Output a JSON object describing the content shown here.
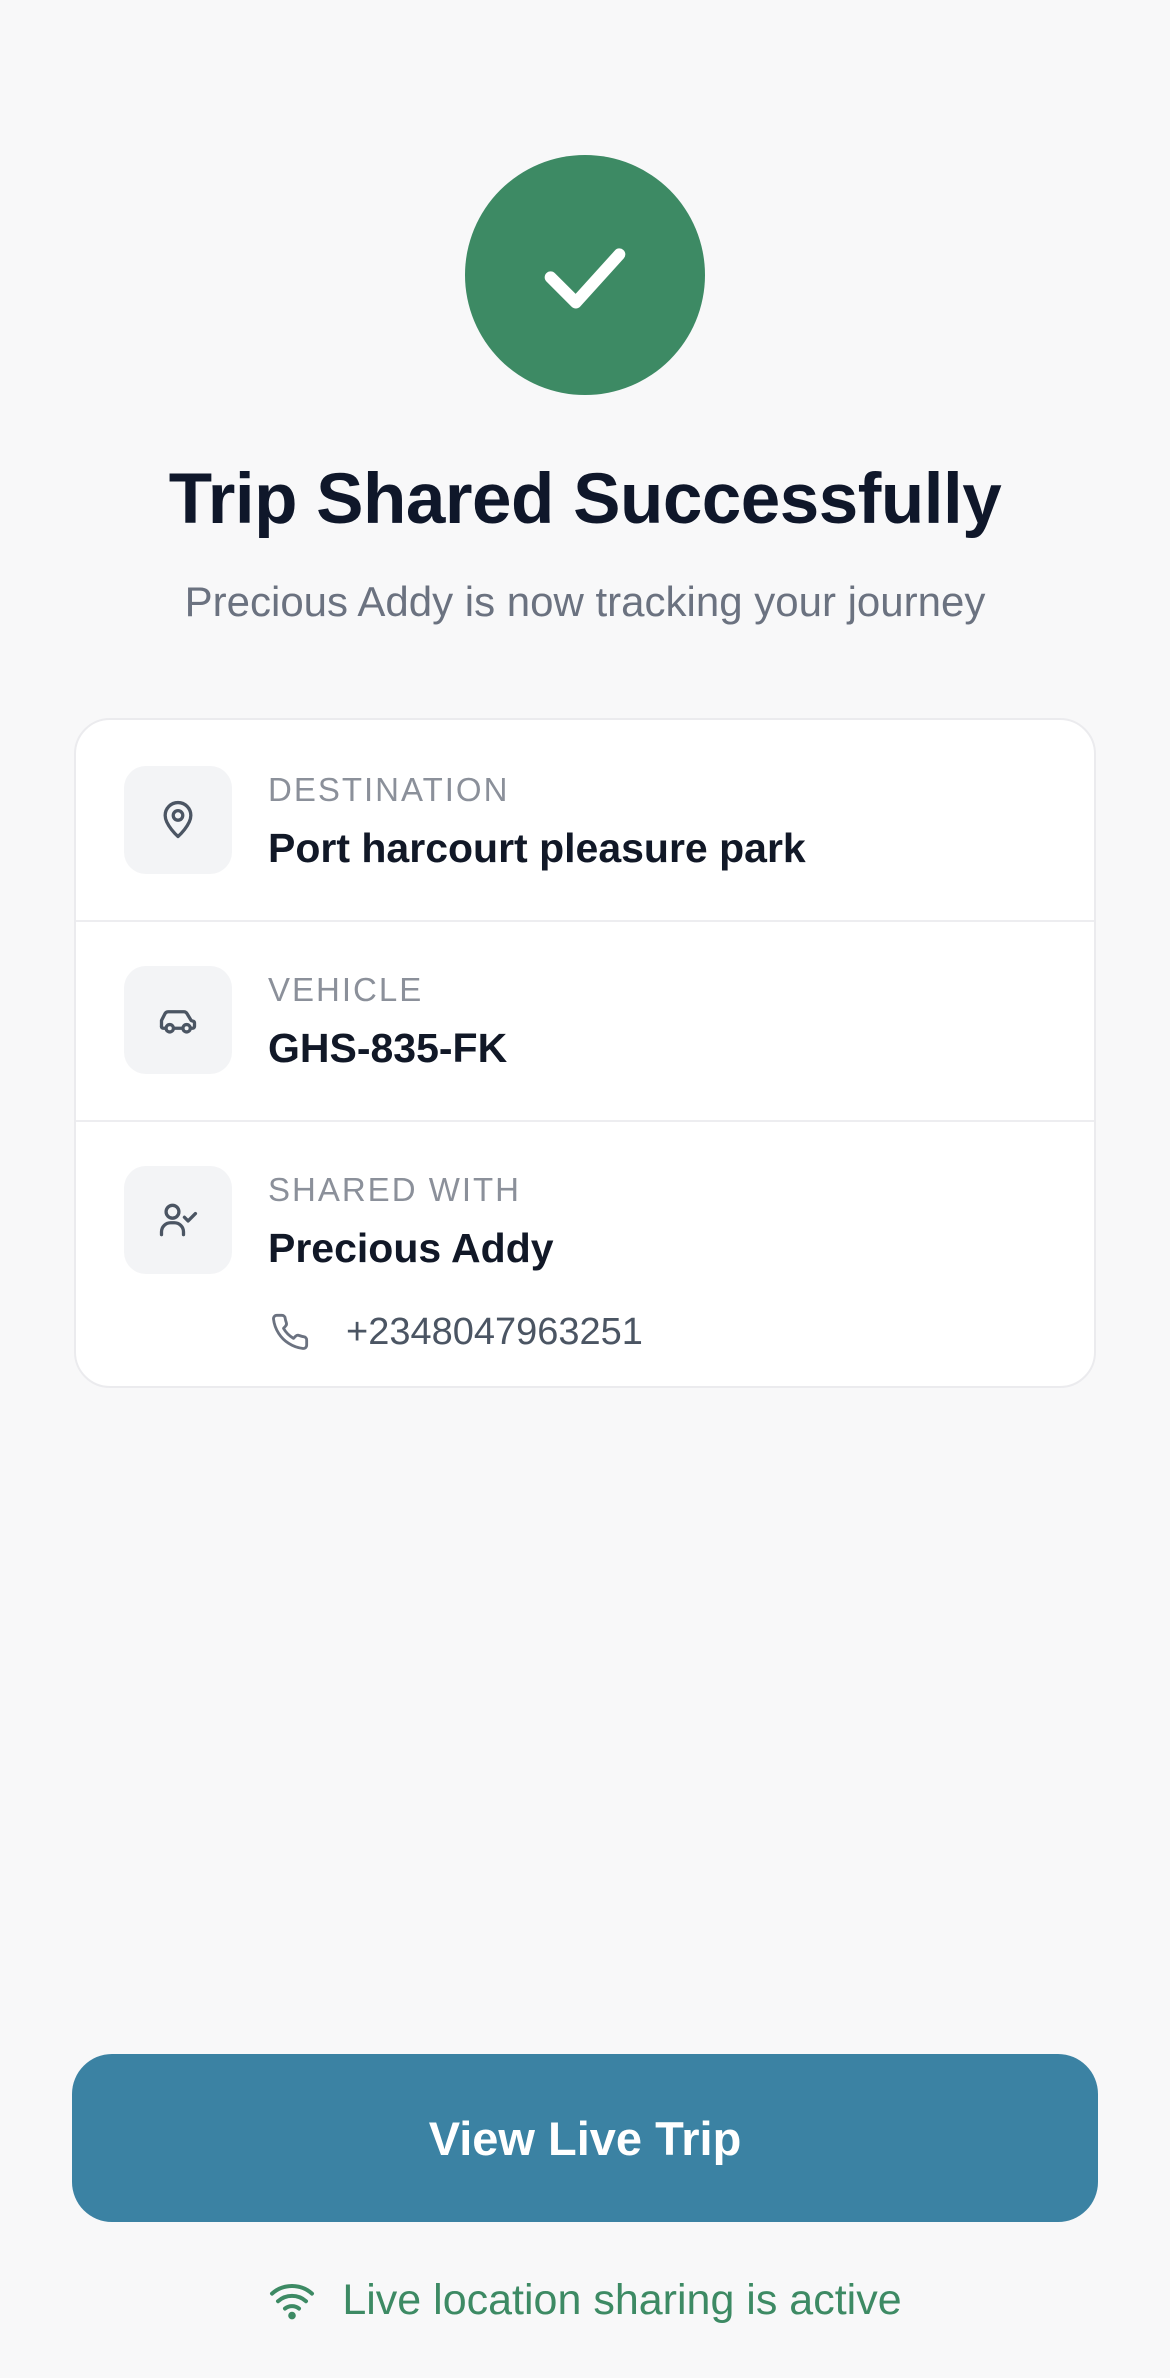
{
  "theme": {
    "success_color": "#3d8a64",
    "primary_button_color": "#3b82a3",
    "background_color": "#f8f8f9"
  },
  "header": {
    "icon": "checkmark-icon",
    "title": "Trip Shared Successfully",
    "subtitle": "Precious Addy is now tracking your journey"
  },
  "trip_details": {
    "destination": {
      "icon": "location-pin-icon",
      "label": "DESTINATION",
      "value": "Port harcourt pleasure park"
    },
    "vehicle": {
      "icon": "car-icon",
      "label": "VEHICLE",
      "value": "GHS-835-FK"
    },
    "shared_with": {
      "icon": "user-check-icon",
      "label": "SHARED WITH",
      "value": "Precious Addy",
      "phone_icon": "phone-icon",
      "phone": "+2348047963251"
    }
  },
  "actions": {
    "view_live_trip_label": "View Live Trip"
  },
  "status": {
    "icon": "wifi-icon",
    "text": "Live location sharing is active"
  }
}
